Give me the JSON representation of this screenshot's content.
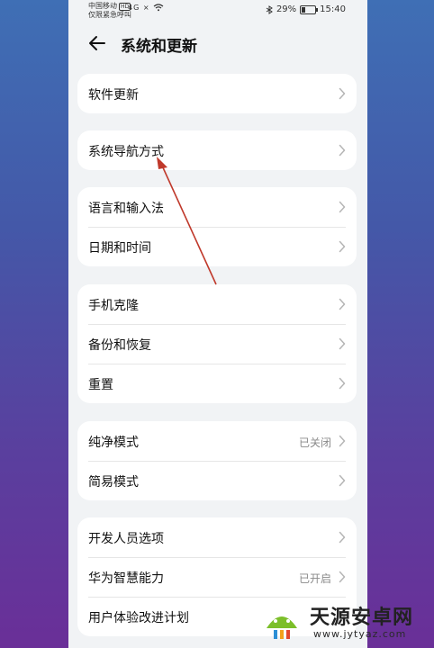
{
  "status_bar": {
    "carrier_line1": "中国移动",
    "carrier_badge": "HD",
    "carrier_line2": "仅限紧急呼叫",
    "signal_text": "4G ×",
    "battery": "29%",
    "time": "15:40"
  },
  "header": {
    "title": "系统和更新"
  },
  "groups": [
    {
      "items": [
        {
          "label": "软件更新",
          "value": ""
        }
      ]
    },
    {
      "items": [
        {
          "label": "系统导航方式",
          "value": ""
        }
      ]
    },
    {
      "items": [
        {
          "label": "语言和输入法",
          "value": ""
        },
        {
          "label": "日期和时间",
          "value": ""
        }
      ]
    },
    {
      "items": [
        {
          "label": "手机克隆",
          "value": ""
        },
        {
          "label": "备份和恢复",
          "value": ""
        },
        {
          "label": "重置",
          "value": ""
        }
      ]
    },
    {
      "items": [
        {
          "label": "纯净模式",
          "value": "已关闭"
        },
        {
          "label": "简易模式",
          "value": ""
        }
      ]
    },
    {
      "items": [
        {
          "label": "开发人员选项",
          "value": ""
        },
        {
          "label": "华为智慧能力",
          "value": "已开启"
        },
        {
          "label": "用户体验改进计划",
          "value": ""
        }
      ]
    }
  ],
  "watermark": {
    "title": "天源安卓网",
    "url": "www.jytyaz.com"
  },
  "colors": {
    "annotation_arrow": "#c0392b",
    "chevron": "#b5b5b5"
  }
}
